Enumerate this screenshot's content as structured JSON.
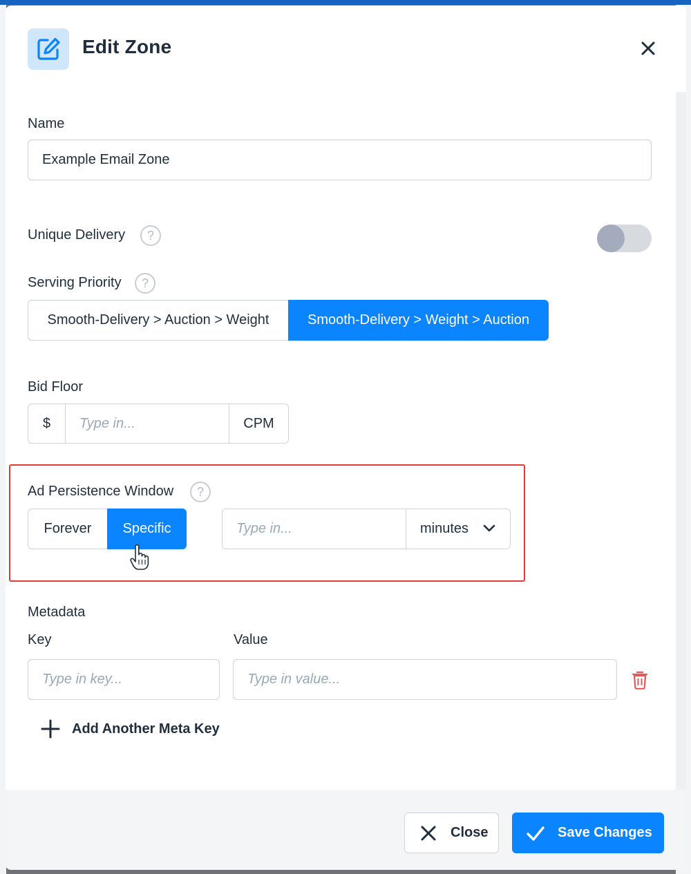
{
  "modal": {
    "title": "Edit Zone",
    "icon": "edit-icon",
    "close_icon": "close-icon"
  },
  "name_field": {
    "label": "Name",
    "value": "Example Email Zone"
  },
  "unique_delivery": {
    "label": "Unique Delivery",
    "help": "?",
    "enabled": false
  },
  "serving_priority": {
    "label": "Serving Priority",
    "help": "?",
    "options": [
      "Smooth-Delivery > Auction > Weight",
      "Smooth-Delivery > Weight > Auction"
    ],
    "selected": "Smooth-Delivery > Weight > Auction"
  },
  "bid_floor": {
    "label": "Bid Floor",
    "prefix": "$",
    "placeholder": "Type in...",
    "suffix": "CPM"
  },
  "ad_persistence": {
    "label": "Ad Persistence Window",
    "help": "?",
    "options": [
      "Forever",
      "Specific"
    ],
    "selected": "Specific",
    "placeholder": "Type in...",
    "unit": "minutes"
  },
  "metadata": {
    "label": "Metadata",
    "key_label": "Key",
    "value_label": "Value",
    "key_placeholder": "Type in key...",
    "value_placeholder": "Type in value...",
    "add_label": "Add Another Meta Key"
  },
  "footer": {
    "close_label": "Close",
    "save_label": "Save Changes"
  },
  "colors": {
    "accent": "#0a84ff",
    "danger": "#e53935"
  }
}
